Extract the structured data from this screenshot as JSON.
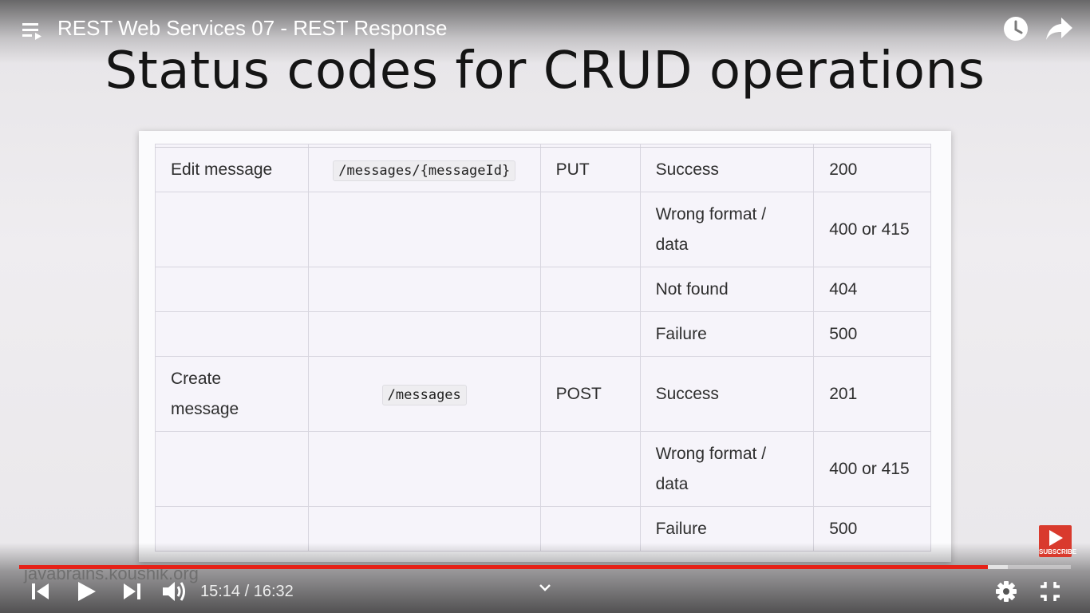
{
  "player": {
    "video_title": "REST Web Services 07 - REST Response",
    "current_time": "15:14",
    "separator": " / ",
    "duration": "16:32",
    "progress_fraction": 0.921,
    "buffered_fraction": 0.94,
    "subscribe_label": "SUBSCRIBE",
    "accent_color": "#e62117",
    "icons": {
      "playlist": "playlist-icon",
      "watch_later": "clock-icon",
      "share": "share-arrow-icon",
      "previous": "skip-previous-icon",
      "play": "play-icon",
      "next": "skip-next-icon",
      "volume": "volume-icon",
      "chevron": "chevron-down-icon",
      "settings": "gear-icon",
      "exit_fullscreen": "exit-fullscreen-icon"
    }
  },
  "slide": {
    "title": "Status codes for CRUD operations",
    "watermark": "javabrains.koushik.org",
    "rows": [
      {
        "action": "Edit message",
        "path": "/messages/{messageId}",
        "method": "PUT",
        "result": "Success",
        "code": "200"
      },
      {
        "action": "",
        "path": "",
        "method": "",
        "result": "Wrong format / data",
        "code": "400 or 415"
      },
      {
        "action": "",
        "path": "",
        "method": "",
        "result": "Not found",
        "code": "404"
      },
      {
        "action": "",
        "path": "",
        "method": "",
        "result": "Failure",
        "code": "500"
      },
      {
        "action": "Create message",
        "path": "/messages",
        "method": "POST",
        "result": "Success",
        "code": "201"
      },
      {
        "action": "",
        "path": "",
        "method": "",
        "result": "Wrong format / data",
        "code": "400 or 415"
      },
      {
        "action": "",
        "path": "",
        "method": "",
        "result": "Failure",
        "code": "500"
      }
    ]
  }
}
